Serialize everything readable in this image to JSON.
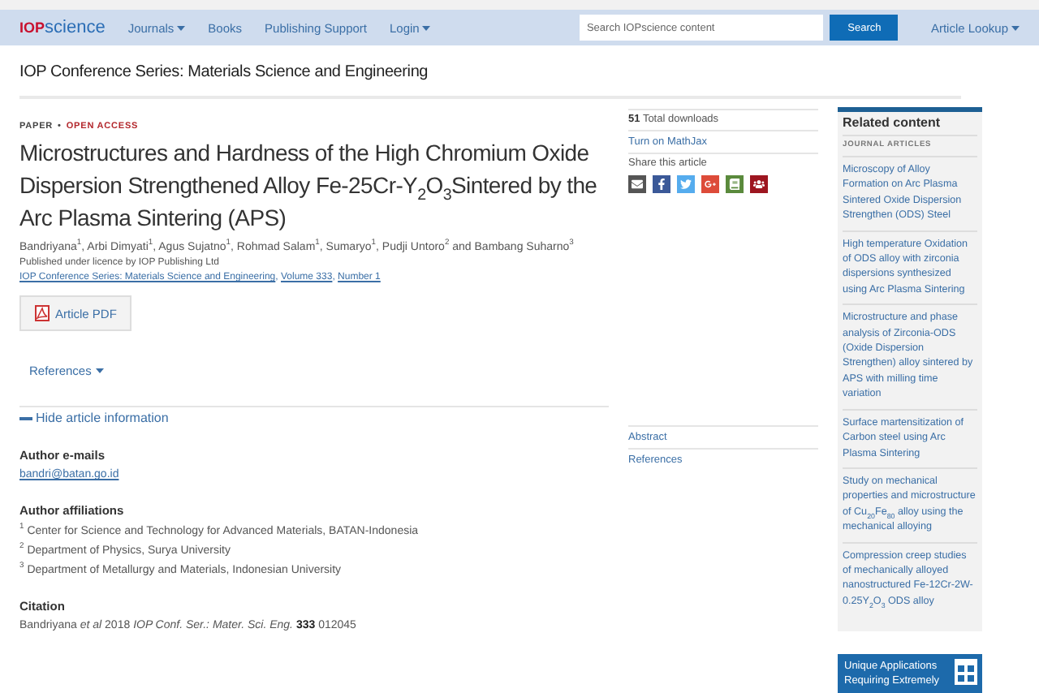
{
  "nav": {
    "logo": {
      "part_a": "IOP",
      "part_b": "science"
    },
    "menu": [
      {
        "label": "Journals",
        "dropdown": true
      },
      {
        "label": "Books",
        "dropdown": false
      },
      {
        "label": "Publishing Support",
        "dropdown": false
      },
      {
        "label": "Login",
        "dropdown": true
      }
    ],
    "search": {
      "placeholder": "Search IOPscience content",
      "button": "Search"
    },
    "lookup": {
      "label": "Article Lookup",
      "dropdown": true
    }
  },
  "journal_title": "IOP Conference Series: Materials Science and Engineering",
  "article": {
    "type": "PAPER",
    "separator": "•",
    "access": "OPEN ACCESS",
    "title": "Microstructures and Hardness of the High Chromium Oxide Dispersion Strengthened Alloy Fe-25Cr-Y$_{2}$O$_{3}$Sintered by the Arc Plasma Sintering (APS)",
    "authors": "Bandriyana$^{1}$, Arbi Dimyati$^{1}$, Agus Sujatno$^{1}$, Rohmad Salam$^{1}$, Sumaryo$^{1}$, Pudji Untoro$^{2}$ and Bambang Suharno$^{3}$",
    "licence": "Published under licence by IOP Publishing Ltd",
    "source_links": [
      {
        "text": "IOP Conference Series: Materials Science and Engineering",
        "after": ","
      },
      {
        "text": "Volume 333",
        "after": ","
      },
      {
        "text": "Number 1"
      }
    ],
    "pdf_button": "Article PDF",
    "references_toggle": {
      "label": "References",
      "dropdown": true
    },
    "info_toggle": {
      "label": "Hide article information",
      "expanded": true
    },
    "emails_heading": "Author e-mails",
    "emails": [
      "bandri@batan.go.id"
    ],
    "affiliations_heading": "Author affiliations",
    "affiliations": [
      {
        "mark": "1",
        "text": "Center for Science and Technology for Advanced Materials, BATAN-Indonesia"
      },
      {
        "mark": "2",
        "text": "Department of Physics, Surya University"
      },
      {
        "mark": "3",
        "text": "Department of Metallurgy and Materials, Indonesian University"
      }
    ],
    "citation_heading": "Citation",
    "citation": "Bandriyana *et al* 2018 *IOP Conf. Ser.: Mater. Sci. Eng.* **333** 012045"
  },
  "side": {
    "downloads": {
      "count": "51",
      "label": "Total downloads"
    },
    "mathjax": "Turn on MathJax",
    "share_label": "Share this article",
    "share_icons": [
      {
        "kind": "email",
        "color": "#555555"
      },
      {
        "kind": "facebook",
        "color": "#3b5998"
      },
      {
        "kind": "twitter",
        "color": "#55acee"
      },
      {
        "kind": "google",
        "color": "#dd4b39"
      },
      {
        "kind": "bookmark",
        "color": "#5a8a3c"
      },
      {
        "kind": "mendeley",
        "color": "#9d1620"
      }
    ],
    "sections": [
      "Abstract",
      "References"
    ]
  },
  "related": {
    "heading": "Related content",
    "subheading": "JOURNAL ARTICLES",
    "items": [
      "Microscopy of Alloy Formation on Arc Plasma Sintered Oxide Dispersion Strengthen (ODS) Steel",
      "High temperature Oxidation of ODS alloy with zirconia dispersions synthesized using Arc Plasma Sintering",
      "Microstructure and phase analysis of Zirconia-ODS (Oxide Dispersion Strengthen) alloy sintered by APS with milling time variation",
      "Surface martensitization of Carbon steel using Arc Plasma Sintering",
      "Study on mechanical properties and microstructure of Cu$_{20}$Fe$_{80}$ alloy using the mechanical alloying",
      "Compression creep studies of mechanically alloyed nanostructured Fe-12Cr-2W-0.25Y$_{2}$O$_{3}$ ODS alloy"
    ]
  },
  "ad": {
    "text": "Unique Applications Requiring Extremely"
  }
}
